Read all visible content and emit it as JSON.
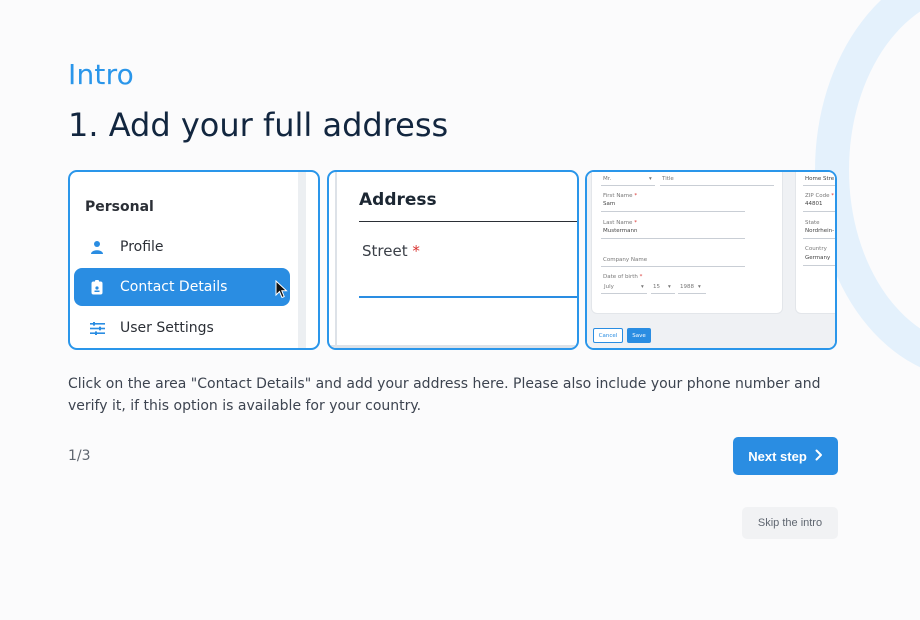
{
  "intro": {
    "eyebrow": "Intro",
    "title": "1. Add your full address",
    "description": "Click on the area \"Contact Details\" and add your address here. Please also include your phone number and verify it, if this option is available for your country.",
    "counter": "1/3",
    "next_label": "Next step",
    "skip_label": "Skip the intro"
  },
  "card1": {
    "section": "Personal",
    "items": [
      {
        "label": "Profile",
        "icon": "person-icon"
      },
      {
        "label": "Contact Details",
        "icon": "contact-card-icon",
        "active": true
      },
      {
        "label": "User Settings",
        "icon": "sliders-icon"
      }
    ]
  },
  "card2": {
    "heading": "Address",
    "field_label": "Street",
    "required_mark": "*"
  },
  "card3": {
    "salutation": "Mr.",
    "title_placeholder": "Title",
    "first_name_label": "First Name",
    "first_name_value": "Sam",
    "last_name_label": "Last Name",
    "last_name_value": "Mustermann",
    "company_label": "Company Name",
    "dob_label": "Date of birth",
    "dob_month": "July",
    "dob_day": "15",
    "dob_year": "1988",
    "street_value": "Home Stre",
    "zip_label": "ZIP Code",
    "zip_value": "44801",
    "state_label": "State",
    "state_value": "Nordrhein-",
    "country_label": "Country",
    "country_value": "Germany",
    "cancel_label": "Cancel",
    "save_label": "Save",
    "required_mark": "*"
  },
  "colors": {
    "accent": "#2a8de2",
    "heading": "#12263f",
    "eyebrow": "#2a96ea",
    "required": "#d9322f"
  }
}
